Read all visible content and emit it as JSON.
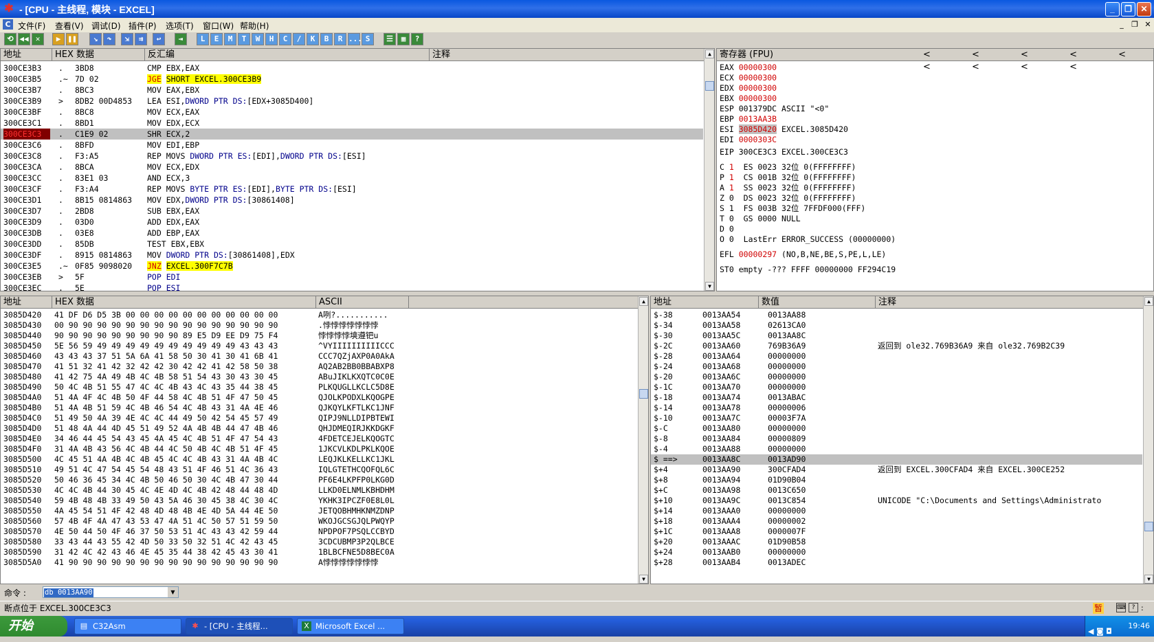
{
  "window": {
    "title": "- [CPU - 主线程, 模块 - EXCEL]",
    "min": "_",
    "restore": "❐",
    "close": "✕"
  },
  "menu": {
    "items": [
      "文件(F)",
      "查看(V)",
      "调试(D)",
      "插件(P)",
      "选项(T)",
      "窗口(W)",
      "帮助(H)"
    ],
    "mdi": [
      "_",
      "❐",
      "✕"
    ]
  },
  "toolbar": {
    "letters": [
      "L",
      "E",
      "M",
      "T",
      "W",
      "H",
      "C",
      "/",
      "K",
      "B",
      "R",
      "...",
      "S"
    ]
  },
  "disasm": {
    "headers": {
      "addr": "地址",
      "hex": "HEX 数据",
      "dis": "反汇编",
      "cmt": "注释"
    },
    "rows": [
      {
        "a": "300CE3B3",
        "m": ".",
        "h": "3BD8",
        "d": "CMP EBX,EAX"
      },
      {
        "a": "300CE3B5",
        "m": ".~",
        "h": "7D 02",
        "d": "JGE SHORT EXCEL.300CE3B9",
        "hl": true,
        "hp": "JGE",
        "hr": "SHORT EXCEL.300CE3B9"
      },
      {
        "a": "300CE3B7",
        "m": ".",
        "h": "8BC3",
        "d": "MOV EAX,EBX"
      },
      {
        "a": "300CE3B9",
        "m": ">",
        "h": "8DB2 00D4853",
        "d": "LEA ESI,DWORD PTR DS:[EDX+3085D400]"
      },
      {
        "a": "300CE3BF",
        "m": ".",
        "h": "8BC8",
        "d": "MOV ECX,EAX"
      },
      {
        "a": "300CE3C1",
        "m": ".",
        "h": "8BD1",
        "d": "MOV EDX,ECX"
      },
      {
        "a": "300CE3C3",
        "m": ".",
        "h": "C1E9 02",
        "d": "SHR ECX,2",
        "eip": true
      },
      {
        "a": "300CE3C6",
        "m": ".",
        "h": "8BFD",
        "d": "MOV EDI,EBP"
      },
      {
        "a": "300CE3C8",
        "m": ".",
        "h": "F3:A5",
        "d": "REP MOVS DWORD PTR ES:[EDI],DWORD PTR DS:[ESI]"
      },
      {
        "a": "300CE3CA",
        "m": ".",
        "h": "8BCA",
        "d": "MOV ECX,EDX"
      },
      {
        "a": "300CE3CC",
        "m": ".",
        "h": "83E1 03",
        "d": "AND ECX,3"
      },
      {
        "a": "300CE3CF",
        "m": ".",
        "h": "F3:A4",
        "d": "REP MOVS BYTE PTR ES:[EDI],BYTE PTR DS:[ESI]"
      },
      {
        "a": "300CE3D1",
        "m": ".",
        "h": "8B15 0814863",
        "d": "MOV EDX,DWORD PTR DS:[30861408]"
      },
      {
        "a": "300CE3D7",
        "m": ".",
        "h": "2BD8",
        "d": "SUB EBX,EAX"
      },
      {
        "a": "300CE3D9",
        "m": ".",
        "h": "03D0",
        "d": "ADD EDX,EAX"
      },
      {
        "a": "300CE3DB",
        "m": ".",
        "h": "03E8",
        "d": "ADD EBP,EAX"
      },
      {
        "a": "300CE3DD",
        "m": ".",
        "h": "85DB",
        "d": "TEST EBX,EBX"
      },
      {
        "a": "300CE3DF",
        "m": ".",
        "h": "8915 0814863",
        "d": "MOV DWORD PTR DS:[30861408],EDX"
      },
      {
        "a": "300CE3E5",
        "m": ".~",
        "h": "0F85 9098020",
        "d": "JNZ EXCEL.300F7C7B",
        "hl": true,
        "hp": "JNZ",
        "hr": "EXCEL.300F7C7B"
      },
      {
        "a": "300CE3EB",
        "m": ">",
        "h": "5F",
        "d": "POP EDI"
      },
      {
        "a": "300CE3EC",
        "m": ".",
        "h": "5E",
        "d": "POP ESI"
      }
    ]
  },
  "registers": {
    "title": "寄存器 (FPU)",
    "arrows": "< < < < < < < < <",
    "regs": [
      {
        "n": "EAX",
        "v": "00000300",
        "c": ""
      },
      {
        "n": "ECX",
        "v": "00000300",
        "c": ""
      },
      {
        "n": "EDX",
        "v": "00000300",
        "c": ""
      },
      {
        "n": "EBX",
        "v": "00000300",
        "c": ""
      },
      {
        "n": "ESP",
        "v": "001379DC",
        "c": "ASCII \"<0\""
      },
      {
        "n": "EBP",
        "v": "0013AA3B",
        "c": ""
      },
      {
        "n": "ESI",
        "v": "3085D420",
        "c": "EXCEL.3085D420"
      },
      {
        "n": "EDI",
        "v": "0000303C",
        "c": ""
      }
    ],
    "eip": "EIP 300CE3C3 EXCEL.300CE3C3",
    "flags": [
      {
        "f": "C",
        "v": "1",
        "s": "ES 0023 32位 0(FFFFFFFF)"
      },
      {
        "f": "P",
        "v": "1",
        "s": "CS 001B 32位 0(FFFFFFFF)"
      },
      {
        "f": "A",
        "v": "1",
        "s": "SS 0023 32位 0(FFFFFFFF)"
      },
      {
        "f": "Z",
        "v": "0",
        "s": "DS 0023 32位 0(FFFFFFFF)"
      },
      {
        "f": "S",
        "v": "1",
        "s": "FS 003B 32位 7FFDF000(FFF)"
      },
      {
        "f": "T",
        "v": "0",
        "s": "GS 0000 NULL"
      },
      {
        "f": "D",
        "v": "0",
        "s": ""
      },
      {
        "f": "O",
        "v": "0",
        "s": "LastErr ERROR_SUCCESS (00000000)"
      }
    ],
    "efl": {
      "label": "EFL",
      "value": "00000297",
      "desc": "(NO,B,NE,BE,S,PE,L,LE)"
    },
    "st0": "ST0 empty -??? FFFF 00000000 FF294C19"
  },
  "dump": {
    "headers": {
      "addr": "地址",
      "hex": "HEX 数据",
      "ascii": "ASCII"
    },
    "rows": [
      {
        "a": "3085D420",
        "h": "41 DF D6 D5 3B 00 00 00 00 00 00 00 00 00 00 00",
        "s": "A咧?..........."
      },
      {
        "a": "3085D430",
        "h": "00 90 90 90 90 90 90 90 90 90 90 90 90 90 90 90",
        "s": ".悖悖悖悖悖悖悖"
      },
      {
        "a": "3085D440",
        "h": "90 90 90 90 90 90 90 90 90 89 E5 D9 EE D9 75 F4",
        "s": "悖悖悖悖塽遵钯u"
      },
      {
        "a": "3085D450",
        "h": "5E 56 59 49 49 49 49 49 49 49 49 49 49 43 43 43",
        "s": "^VYIIIIIIIIIICCC"
      },
      {
        "a": "3085D460",
        "h": "43 43 43 37 51 5A 6A 41 58 50 30 41 30 41 6B 41",
        "s": "CCC7QZjAXP0A0AkA"
      },
      {
        "a": "3085D470",
        "h": "41 51 32 41 42 32 42 42 30 42 42 41 42 58 50 38",
        "s": "AQ2AB2BB0BBABXP8"
      },
      {
        "a": "3085D480",
        "h": "41 42 75 4A 49 4B 4C 4B 58 51 54 43 30 43 30 45",
        "s": "ABuJIKLKXQTC0C0E"
      },
      {
        "a": "3085D490",
        "h": "50 4C 4B 51 55 47 4C 4C 4B 43 4C 43 35 44 38 45",
        "s": "PLKQUGLLKCLC5D8E"
      },
      {
        "a": "3085D4A0",
        "h": "51 4A 4F 4C 4B 50 4F 44 58 4C 4B 51 4F 47 50 45",
        "s": "QJOLKPODXLKQOGPE"
      },
      {
        "a": "3085D4B0",
        "h": "51 4A 4B 51 59 4C 4B 46 54 4C 4B 43 31 4A 4E 46",
        "s": "QJKQYLKFTLKC1JNF"
      },
      {
        "a": "3085D4C0",
        "h": "51 49 50 4A 39 4E 4C 4C 44 49 50 42 54 45 57 49",
        "s": "QIPJ9NLLDIPBTEWI"
      },
      {
        "a": "3085D4D0",
        "h": "51 48 4A 44 4D 45 51 49 52 4A 4B 4B 44 47 4B 46",
        "s": "QHJDMEQIRJKKDGKF"
      },
      {
        "a": "3085D4E0",
        "h": "34 46 44 45 54 43 45 4A 45 4C 4B 51 4F 47 54 43",
        "s": "4FDETCEJELKQOGTC"
      },
      {
        "a": "3085D4F0",
        "h": "31 4A 4B 43 56 4C 4B 44 4C 50 4B 4C 4B 51 4F 45",
        "s": "1JKCVLKDLPKLKQOE"
      },
      {
        "a": "3085D500",
        "h": "4C 45 51 4A 4B 4C 4B 45 4C 4C 4B 43 31 4A 4B 4C",
        "s": "LEQJKLKELLKC1JKL"
      },
      {
        "a": "3085D510",
        "h": "49 51 4C 47 54 45 54 48 43 51 4F 46 51 4C 36 43",
        "s": "IQLGTETHCQOFQL6C"
      },
      {
        "a": "3085D520",
        "h": "50 46 36 45 34 4C 4B 50 46 50 30 4C 4B 47 30 44",
        "s": "PF6E4LKPFP0LKG0D"
      },
      {
        "a": "3085D530",
        "h": "4C 4C 4B 44 30 45 4C 4E 4D 4C 4B 42 48 44 48 4D",
        "s": "LLKD0ELNMLKBHDHM"
      },
      {
        "a": "3085D540",
        "h": "59 4B 48 4B 33 49 50 43 5A 46 30 45 38 4C 30 4C",
        "s": "YKHK3IPCZF0E8L0L"
      },
      {
        "a": "3085D550",
        "h": "4A 45 54 51 4F 42 48 4D 48 4B 4E 4D 5A 44 4E 50",
        "s": "JETQOBHMHKNMZDNP"
      },
      {
        "a": "3085D560",
        "h": "57 4B 4F 4A 47 43 53 47 4A 51 4C 50 57 51 59 50",
        "s": "WKOJGCSGJQLPWQYP"
      },
      {
        "a": "3085D570",
        "h": "4E 50 44 50 4F 46 37 50 53 51 4C 43 43 42 59 44",
        "s": "NPDPOF7PSQLCCBYD"
      },
      {
        "a": "3085D580",
        "h": "33 43 44 43 55 42 4D 50 33 50 32 51 4C 42 43 45",
        "s": "3CDCUBMP3P2QLBCE"
      },
      {
        "a": "3085D590",
        "h": "31 42 4C 42 43 46 4E 45 35 44 38 42 45 43 30 41",
        "s": "1BLBCFNE5D8BEC0A"
      },
      {
        "a": "3085D5A0",
        "h": "41 90 90 90 90 90 90 90 90 90 90 90 90 90 90 90",
        "s": "A悖悖悖悖悖悖悖"
      }
    ]
  },
  "stack": {
    "headers": {
      "addr": "地址",
      "val": "数值",
      "cmt": "注释"
    },
    "rows": [
      {
        "o": "$-38",
        "a": "0013AA54",
        "v": "0013AA88",
        "c": ""
      },
      {
        "o": "$-34",
        "a": "0013AA58",
        "v": "02613CA0",
        "c": ""
      },
      {
        "o": "$-30",
        "a": "0013AA5C",
        "v": "0013AA8C",
        "c": ""
      },
      {
        "o": "$-2C",
        "a": "0013AA60",
        "v": "769B36A9",
        "c": "返回到 ole32.769B36A9 来自 ole32.769B2C39"
      },
      {
        "o": "$-28",
        "a": "0013AA64",
        "v": "00000000",
        "c": ""
      },
      {
        "o": "$-24",
        "a": "0013AA68",
        "v": "00000000",
        "c": ""
      },
      {
        "o": "$-20",
        "a": "0013AA6C",
        "v": "00000000",
        "c": ""
      },
      {
        "o": "$-1C",
        "a": "0013AA70",
        "v": "00000000",
        "c": ""
      },
      {
        "o": "$-18",
        "a": "0013AA74",
        "v": "0013ABAC",
        "c": ""
      },
      {
        "o": "$-14",
        "a": "0013AA78",
        "v": "00000006",
        "c": ""
      },
      {
        "o": "$-10",
        "a": "0013AA7C",
        "v": "00003F7A",
        "c": ""
      },
      {
        "o": "$-C",
        "a": "0013AA80",
        "v": "00000000",
        "c": ""
      },
      {
        "o": "$-8",
        "a": "0013AA84",
        "v": "00000809",
        "c": ""
      },
      {
        "o": "$-4",
        "a": "0013AA88",
        "v": "00000000",
        "c": ""
      },
      {
        "o": "$ ==>",
        "a": "0013AA8C",
        "v": "0013AD90",
        "c": "",
        "sel": true
      },
      {
        "o": "$+4",
        "a": "0013AA90",
        "v": "300CFAD4",
        "c": "返回到 EXCEL.300CFAD4 来自 EXCEL.300CE252"
      },
      {
        "o": "$+8",
        "a": "0013AA94",
        "v": "01D90B04",
        "c": ""
      },
      {
        "o": "$+C",
        "a": "0013AA98",
        "v": "0013C650",
        "c": ""
      },
      {
        "o": "$+10",
        "a": "0013AA9C",
        "v": "0013C854",
        "c": "UNICODE \"C:\\Documents and Settings\\Administrato"
      },
      {
        "o": "$+14",
        "a": "0013AAA0",
        "v": "00000000",
        "c": ""
      },
      {
        "o": "$+18",
        "a": "0013AAA4",
        "v": "00000002",
        "c": ""
      },
      {
        "o": "$+1C",
        "a": "0013AAA8",
        "v": "0000007F",
        "c": ""
      },
      {
        "o": "$+20",
        "a": "0013AAAC",
        "v": "01D90B58",
        "c": ""
      },
      {
        "o": "$+24",
        "a": "0013AAB0",
        "v": "00000000",
        "c": ""
      },
      {
        "o": "$+28",
        "a": "0013AAB4",
        "v": "0013ADEC",
        "c": ""
      }
    ]
  },
  "command": {
    "label": "命令 :",
    "value": "db 0013AA90"
  },
  "status": {
    "text": "断点位于 EXCEL.300CE3C3",
    "badge": "暂"
  },
  "taskbar": {
    "start": "开始",
    "tasks": [
      "C32Asm",
      "- [CPU - 主线程...",
      "Microsoft Excel ..."
    ],
    "time": "19:46"
  },
  "colors": {
    "accent": "#0a58e0",
    "highlight": "#ffff00",
    "eip": "#800000",
    "regChanged": "#d00000"
  }
}
